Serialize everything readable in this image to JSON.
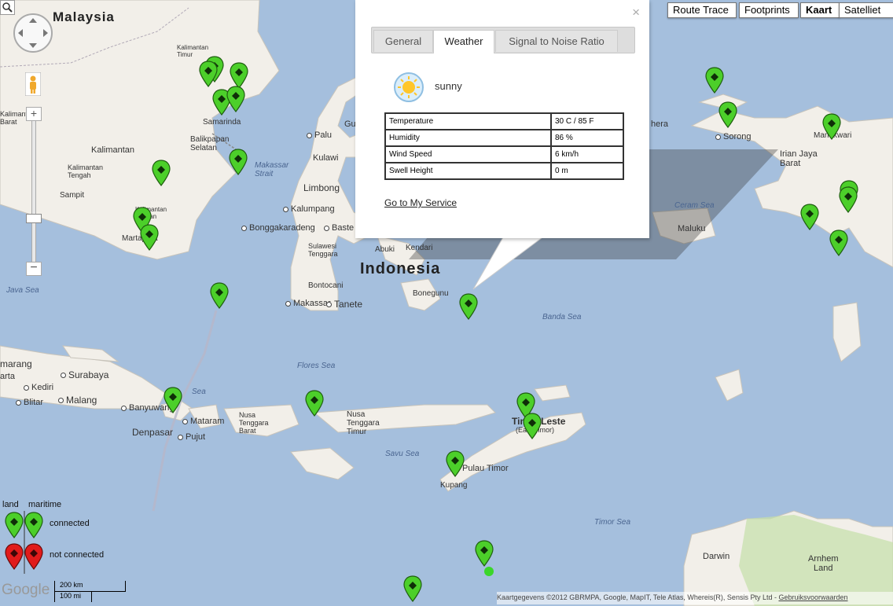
{
  "map": {
    "labels": {
      "malaysia": "Malaysia",
      "indonesia": "Indonesia",
      "irian_jaya_barat": "Irian Jaya\nBarat",
      "timor_leste": "Timor-Leste",
      "east_timor": "(East Timor)",
      "kalimantan": "Kalimantan",
      "kalimantan_timur": "Kalimantan\nTimur",
      "kalimantan_tengah": "Kalimantan\nTengah",
      "kalimantan_selatan": "Kalimantan\nSelatan",
      "kalimantan_barat": "Kalimantan\nBarat",
      "samarinda": "Samarinda",
      "balikpapan": "Balikpapan\nSelatan",
      "sampit": "Sampit",
      "martapura": "Martapura",
      "makassar_strait": "Makassar\nStrait",
      "palu": "Palu",
      "kulawi": "Kulawi",
      "limbong": "Limbong",
      "kalumpang": "Kalumpang",
      "bonggakaradeng": "Bonggakaradeng",
      "baste": "Baste",
      "sulawesi": "Sulawesi\nTenggara",
      "kendari": "Kendari",
      "abuki": "Abuki",
      "bonegunu": "Bonegunu",
      "bontocani": "Bontocani",
      "makassar": "Makassar",
      "tanete": "Tanete",
      "java_sea": "Java Sea",
      "flores_sea": "Flores Sea",
      "banda_sea": "Banda Sea",
      "seram_sea": "Ceram Sea",
      "maluku": "Maluku",
      "sorong": "Sorong",
      "manokwari": "Manokwari",
      "semarang": "marang",
      "surabaya": "Surabaya",
      "kediri": "Kediri",
      "blitar": "Blitar",
      "malang": "Malang",
      "banyuwangi": "Banyuwangi",
      "denpasar": "Denpasar",
      "mataram": "Mataram",
      "pujut": "Pujut",
      "nusa_tenggara_barat": "Nusa\nTenggara\nBarat",
      "nusa_tenggara_timur": "Nusa\nTenggara\nTimur",
      "savu_sea": "Savu Sea",
      "pulau_timor": "Pulau Timor",
      "kupang": "Kupang",
      "timor_sea": "Timor Sea",
      "darwin": "Darwin",
      "arnhem_land": "Arnhem\nLand",
      "bali_sea": "Sea",
      "gu": "Gu",
      "hera": "hera",
      "barat": "Barat",
      "arta": "arta"
    },
    "attribution": "Kaartgegevens ©2012 GBRMPA, Google, MapIT, Tele Atlas, Whereis(R), Sensis Pty Ltd - ",
    "terms_link": "Gebruiksvoorwaarden",
    "google_logo": "Google",
    "scale_km": "200 km",
    "scale_mi": "100 mi"
  },
  "controls": {
    "map_types": [
      "Route Trace",
      "Footprints",
      "Kaart",
      "Satelliet"
    ],
    "active_map_type": "Kaart"
  },
  "popup": {
    "close": "×",
    "tabs": [
      "General",
      "Weather",
      "Signal to Noise Ratio"
    ],
    "active_tab": "Weather",
    "weather_state": "sunny",
    "rows": [
      {
        "key": "Temperature",
        "value": "30 C / 85 F"
      },
      {
        "key": "Humidity",
        "value": "86 %"
      },
      {
        "key": "Wind Speed",
        "value": "6 km/h"
      },
      {
        "key": "Swell Height",
        "value": "0 m"
      }
    ],
    "link": "Go to My Service"
  },
  "legend": {
    "land": "land",
    "maritime": "maritime",
    "connected": "connected",
    "not_connected": "not connected",
    "colors": {
      "connected": "#4ccf2a",
      "not_connected": "#e11b1b"
    }
  }
}
